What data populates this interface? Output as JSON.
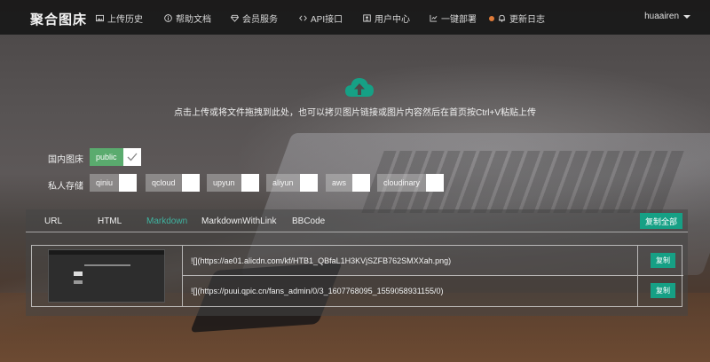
{
  "navbar": {
    "brand": "聚合图床",
    "items": [
      {
        "label": "上传历史",
        "icon": "image-icon"
      },
      {
        "label": "帮助文档",
        "icon": "info-circle-icon"
      },
      {
        "label": "会员服务",
        "icon": "diamond-icon"
      },
      {
        "label": "API接口",
        "icon": "code-icon"
      },
      {
        "label": "用户中心",
        "icon": "user-icon"
      },
      {
        "label": "一键部署",
        "icon": "deploy-icon"
      },
      {
        "label": "更新日志",
        "icon": "bell-icon"
      }
    ],
    "username": "huaairen",
    "update_dot_color": "#e07b39"
  },
  "upload": {
    "hint": "点击上传或将文件拖拽到此处，也可以拷贝图片链接或图片内容然后在首页按Ctrl+V粘贴上传",
    "icon": "cloud-upload-icon",
    "icon_color": "#16a085"
  },
  "storage": {
    "domestic_label": "国内图床",
    "domestic": [
      {
        "name": "public",
        "selected": true
      }
    ],
    "private_label": "私人存储",
    "private": [
      {
        "name": "qiniu",
        "selected": false
      },
      {
        "name": "qcloud",
        "selected": false
      },
      {
        "name": "upyun",
        "selected": false
      },
      {
        "name": "aliyun",
        "selected": false
      },
      {
        "name": "aws",
        "selected": false
      },
      {
        "name": "cloudinary",
        "selected": false
      }
    ]
  },
  "results": {
    "tabs": [
      "URL",
      "HTML",
      "Markdown",
      "MarkdownWithLink",
      "BBCode"
    ],
    "active_tab": "Markdown",
    "copy_all_label": "复制全部",
    "links": [
      {
        "text": "![](https://ae01.alicdn.com/kf/HTB1_QBfaL1H3KVjSZFB762SMXXah.png)",
        "copy_label": "复制"
      },
      {
        "text": "![](https://puui.qpic.cn/fans_admin/0/3_1607768095_1559058931155/0)",
        "copy_label": "复制"
      }
    ],
    "accent_color": "#16a085"
  }
}
